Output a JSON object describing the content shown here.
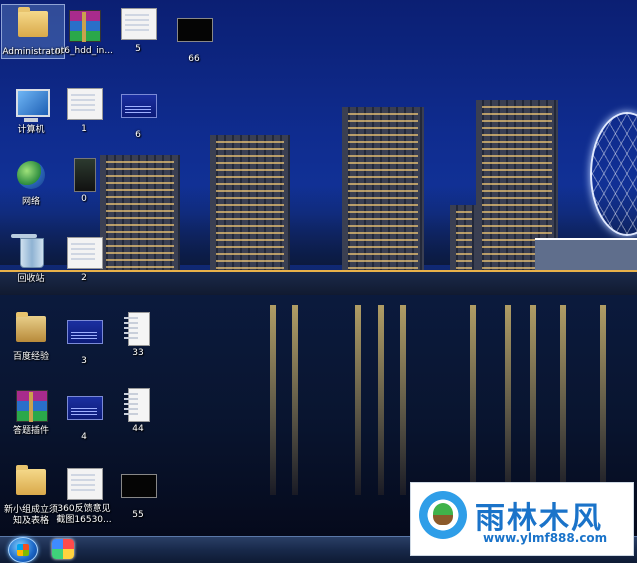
{
  "desktop": {
    "icons": [
      {
        "label": "Administrator"
      },
      {
        "label": "nt6_hdd_in..."
      },
      {
        "label": "5"
      },
      {
        "label": "66"
      },
      {
        "label": "计算机"
      },
      {
        "label": "1"
      },
      {
        "label": "6"
      },
      {
        "label": "网络"
      },
      {
        "label": "0"
      },
      {
        "label": "回收站"
      },
      {
        "label": "2"
      },
      {
        "label": "百度经验"
      },
      {
        "label": "3"
      },
      {
        "label": "33"
      },
      {
        "label": "答题插件"
      },
      {
        "label": "4"
      },
      {
        "label": "44"
      },
      {
        "label": "新小组成立须知及表格"
      },
      {
        "label": "360反馈意见截图16530..."
      },
      {
        "label": "55"
      }
    ]
  },
  "watermark": {
    "title": "雨林木风",
    "url": "www.ylmf888.com"
  },
  "colors": {
    "watermark_text": "#1a73c9",
    "taskbar": "#18294a"
  }
}
